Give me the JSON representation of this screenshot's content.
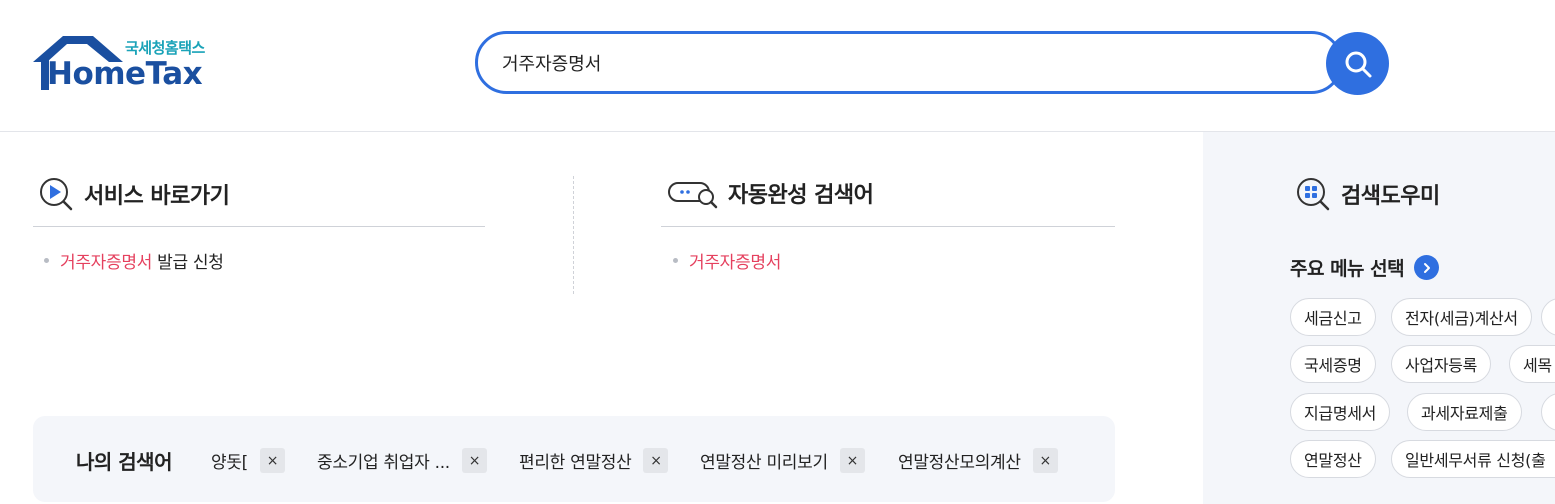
{
  "logo": {
    "korean": "국세청홈택스",
    "english": "HomeTax"
  },
  "search": {
    "value": "거주자증명서",
    "placeholder": ""
  },
  "service_shortcut": {
    "title": "서비스 바로가기",
    "items": [
      {
        "highlight": "거주자증명서",
        "rest": " 발급 신청"
      }
    ]
  },
  "autocomplete": {
    "title": "자동완성 검색어",
    "items": [
      {
        "highlight": "거주자증명서"
      }
    ]
  },
  "my_searches": {
    "title": "나의 검색어",
    "items": [
      "양돗[",
      "중소기업 취업자 ...",
      "편리한 연말정산",
      "연말정산 미리보기",
      "연말정산모의계산"
    ],
    "remove_glyph": "×"
  },
  "helper": {
    "title": "검색도우미",
    "menu_select": "주요 메뉴 선택",
    "menu_rows": [
      [
        "세금신고",
        "전자(세금)계산서"
      ],
      [
        "국세증명",
        "사업자등록",
        "세목"
      ],
      [
        "지급명세서",
        "과세자료제출"
      ],
      [
        "연말정산",
        "일반세무서류 신청(출"
      ]
    ]
  },
  "colors": {
    "accent": "#2f6fe0",
    "highlight": "#e5405e",
    "logo_blue": "#1a4fa0",
    "logo_teal": "#1aa3b8"
  }
}
